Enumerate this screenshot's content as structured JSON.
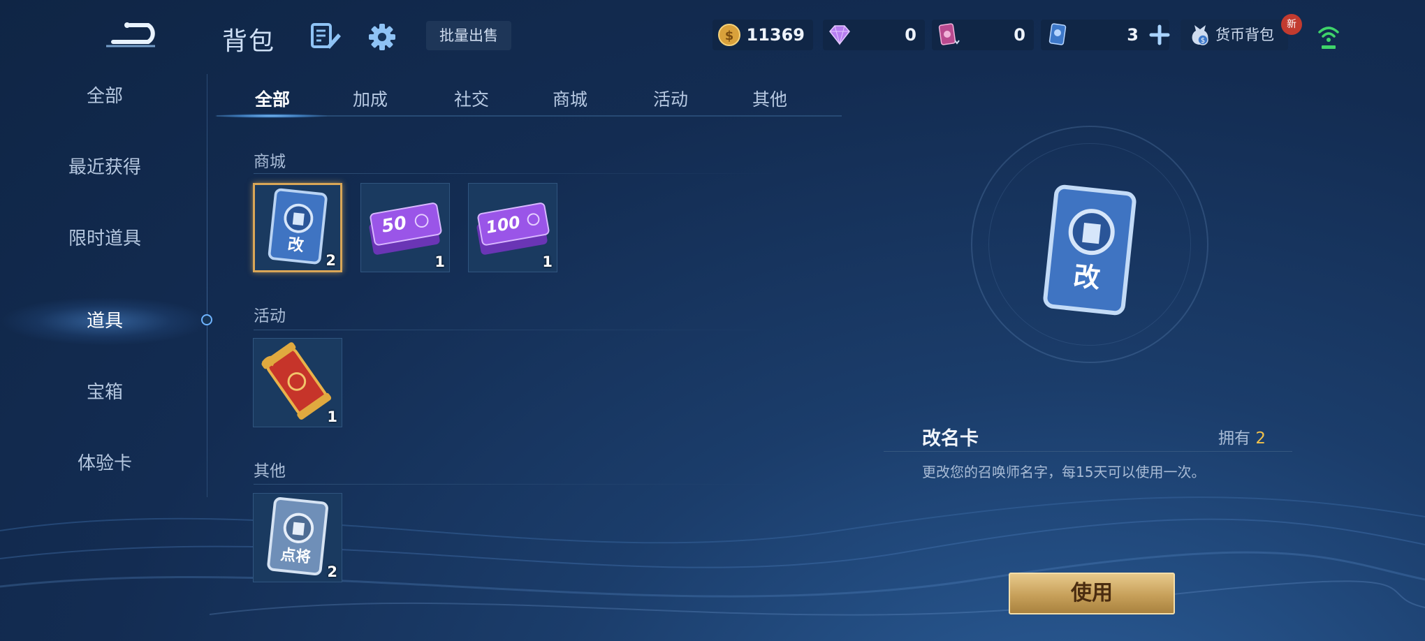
{
  "header": {
    "title": "背包",
    "bulk_sell_label": "批量出售",
    "currencies": [
      {
        "icon": "gold-coin-icon",
        "value": "11369"
      },
      {
        "icon": "purple-diamond-icon",
        "value": "0"
      },
      {
        "icon": "pink-card-icon",
        "value": "0"
      },
      {
        "icon": "blue-card-icon",
        "value": "3"
      }
    ],
    "wallet_label": "货币背包",
    "new_badge": "新"
  },
  "sidebar": {
    "items": [
      {
        "label": "全部"
      },
      {
        "label": "最近获得"
      },
      {
        "label": "限时道具"
      },
      {
        "label": "道具"
      },
      {
        "label": "宝箱"
      },
      {
        "label": "体验卡"
      }
    ],
    "active_index": 3
  },
  "tabs": [
    {
      "label": "全部"
    },
    {
      "label": "加成"
    },
    {
      "label": "社交"
    },
    {
      "label": "商城"
    },
    {
      "label": "活动"
    },
    {
      "label": "其他"
    }
  ],
  "sections": [
    {
      "label": "商城",
      "items": [
        {
          "icon": "rename-card-icon",
          "count": "2",
          "selected": true,
          "card_text": "改"
        },
        {
          "icon": "ticket-50-icon",
          "count": "1",
          "ticket_text": "50"
        },
        {
          "icon": "ticket-100-icon",
          "count": "1",
          "ticket_text": "100"
        }
      ]
    },
    {
      "label": "活动",
      "items": [
        {
          "icon": "scroll-horn-icon",
          "count": "1"
        }
      ]
    },
    {
      "label": "其他",
      "items": [
        {
          "icon": "hero-card-icon",
          "count": "2",
          "card_text": "点将"
        }
      ]
    }
  ],
  "detail": {
    "name": "改名卡",
    "owned_label": "拥有",
    "owned_count": "2",
    "description": "更改您的召唤师名字，每15天可以使用一次。",
    "card_text": "改",
    "use_label": "使用"
  },
  "colors": {
    "accent_gold": "#f3c24b",
    "button_gold": "#c7a05a",
    "bg_dark": "#132c52"
  }
}
